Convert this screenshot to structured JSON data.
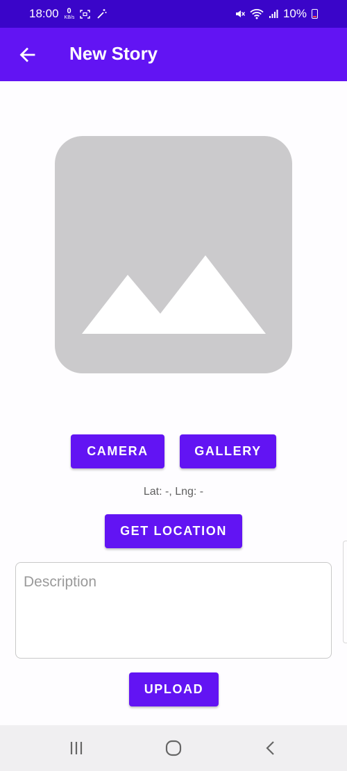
{
  "status_bar": {
    "time": "18:00",
    "data_rate_value": "0",
    "data_rate_unit": "KB/s",
    "battery_percent": "10%",
    "icons": [
      "screenshot-icon",
      "magic-wand-icon",
      "mute-icon",
      "wifi-icon",
      "signal-icon",
      "battery-icon"
    ]
  },
  "app_bar": {
    "title": "New Story",
    "back_icon": "arrow-back-icon",
    "background": "#6214f3"
  },
  "image_preview": {
    "icon": "image-placeholder-icon"
  },
  "buttons": {
    "camera": "CAMERA",
    "gallery": "GALLERY",
    "get_location": "GET LOCATION",
    "upload": "UPLOAD"
  },
  "location": {
    "text": "Lat: -, Lng: -"
  },
  "description": {
    "placeholder": "Description",
    "value": ""
  },
  "nav_bar": {
    "icons": [
      "recents-icon",
      "home-icon",
      "back-icon"
    ]
  },
  "colors": {
    "status_bar": "#3a05c9",
    "primary": "#6214f3",
    "placeholder_gray": "#cbcacc"
  }
}
